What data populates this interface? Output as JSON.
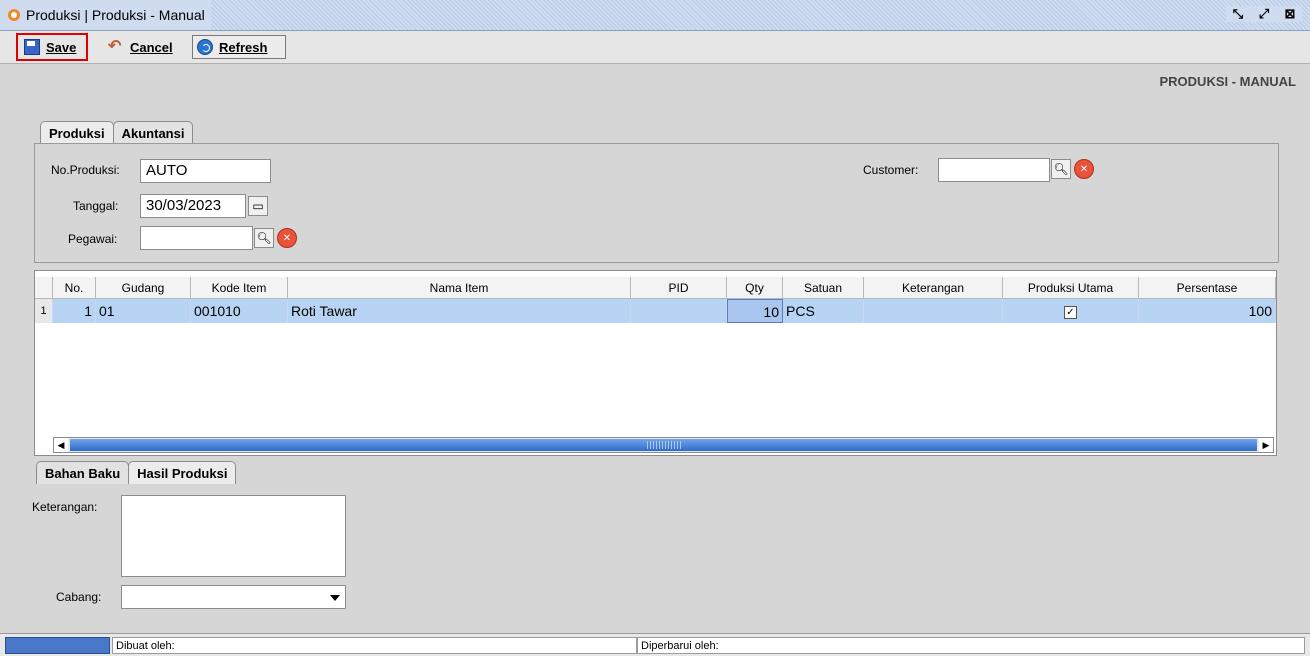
{
  "window": {
    "title": "Produksi | Produksi - Manual"
  },
  "toolbar": {
    "save": "Save",
    "cancel": "Cancel",
    "refresh": "Refresh"
  },
  "page_heading": "PRODUKSI - MANUAL",
  "top_tabs": [
    {
      "label": "Produksi",
      "active": true
    },
    {
      "label": "Akuntansi",
      "active": false
    }
  ],
  "form": {
    "no_produksi": {
      "label": "No.Produksi:",
      "value": "AUTO"
    },
    "tanggal": {
      "label": "Tanggal:",
      "value": "30/03/2023"
    },
    "pegawai": {
      "label": "Pegawai:",
      "value": ""
    },
    "customer": {
      "label": "Customer:",
      "value": ""
    }
  },
  "grid": {
    "columns": [
      "No.",
      "Gudang",
      "Kode Item",
      "Nama Item",
      "PID",
      "Qty",
      "Satuan",
      "Keterangan",
      "Produksi Utama",
      "Persentase"
    ],
    "rows": [
      {
        "row_no": "1",
        "no": "1",
        "gudang": "01",
        "kode_item": "001010",
        "nama_item": "Roti Tawar",
        "pid": "",
        "qty": "10",
        "satuan": "PCS",
        "keterangan": "",
        "produksi_utama": true,
        "persentase": "100"
      }
    ]
  },
  "bottom_tabs": [
    {
      "label": "Bahan Baku",
      "active": false
    },
    {
      "label": "Hasil Produksi",
      "active": true
    }
  ],
  "keterangan": {
    "label": "Keterangan:",
    "value": ""
  },
  "cabang": {
    "label": "Cabang:",
    "value": ""
  },
  "status": {
    "dibuat": "Dibuat oleh:",
    "diperbarui": "Diperbarui oleh:"
  }
}
